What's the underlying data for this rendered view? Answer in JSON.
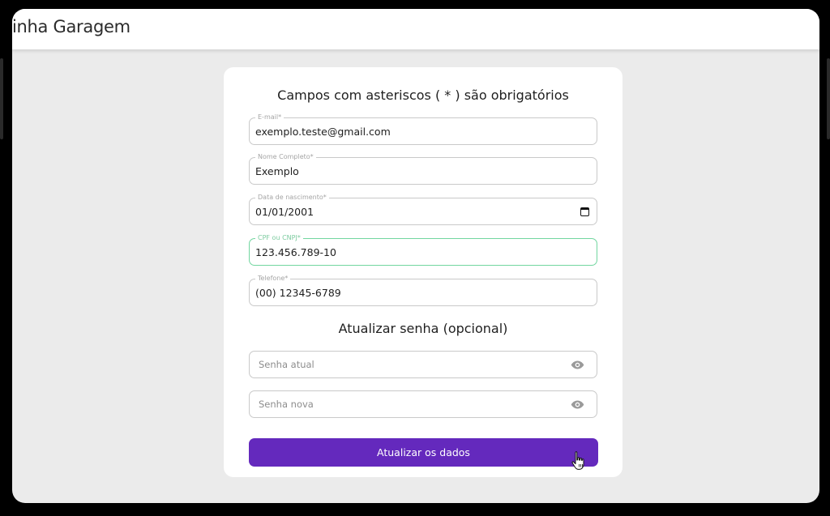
{
  "app": {
    "title": "inha Garagem"
  },
  "form": {
    "heading": "Campos com asteriscos ( * ) são obrigatórios",
    "fields": [
      {
        "label": "E-mail*",
        "value": "exemplo.teste@gmail.com"
      },
      {
        "label": "Nome Completo*",
        "value": "Exemplo"
      },
      {
        "label": "Data de nascimento*",
        "value": "01/01/2001"
      },
      {
        "label": "CPF ou CNPJ*",
        "value": "123.456.789-10"
      },
      {
        "label": "Telefone*",
        "value": "(00) 12345-6789"
      }
    ],
    "password_section": {
      "heading": "Atualizar senha (opcional)",
      "current_placeholder": "Senha atual",
      "new_placeholder": "Senha nova"
    },
    "submit_label": "Atualizar os dados"
  },
  "icons": {
    "date_picker": "calendar-icon",
    "password_toggle": "eye-icon",
    "cursor": "hand-pointer-icon"
  },
  "colors": {
    "accent": "#6429bd",
    "active_border": "#72d6a0",
    "background": "#ebebeb"
  }
}
